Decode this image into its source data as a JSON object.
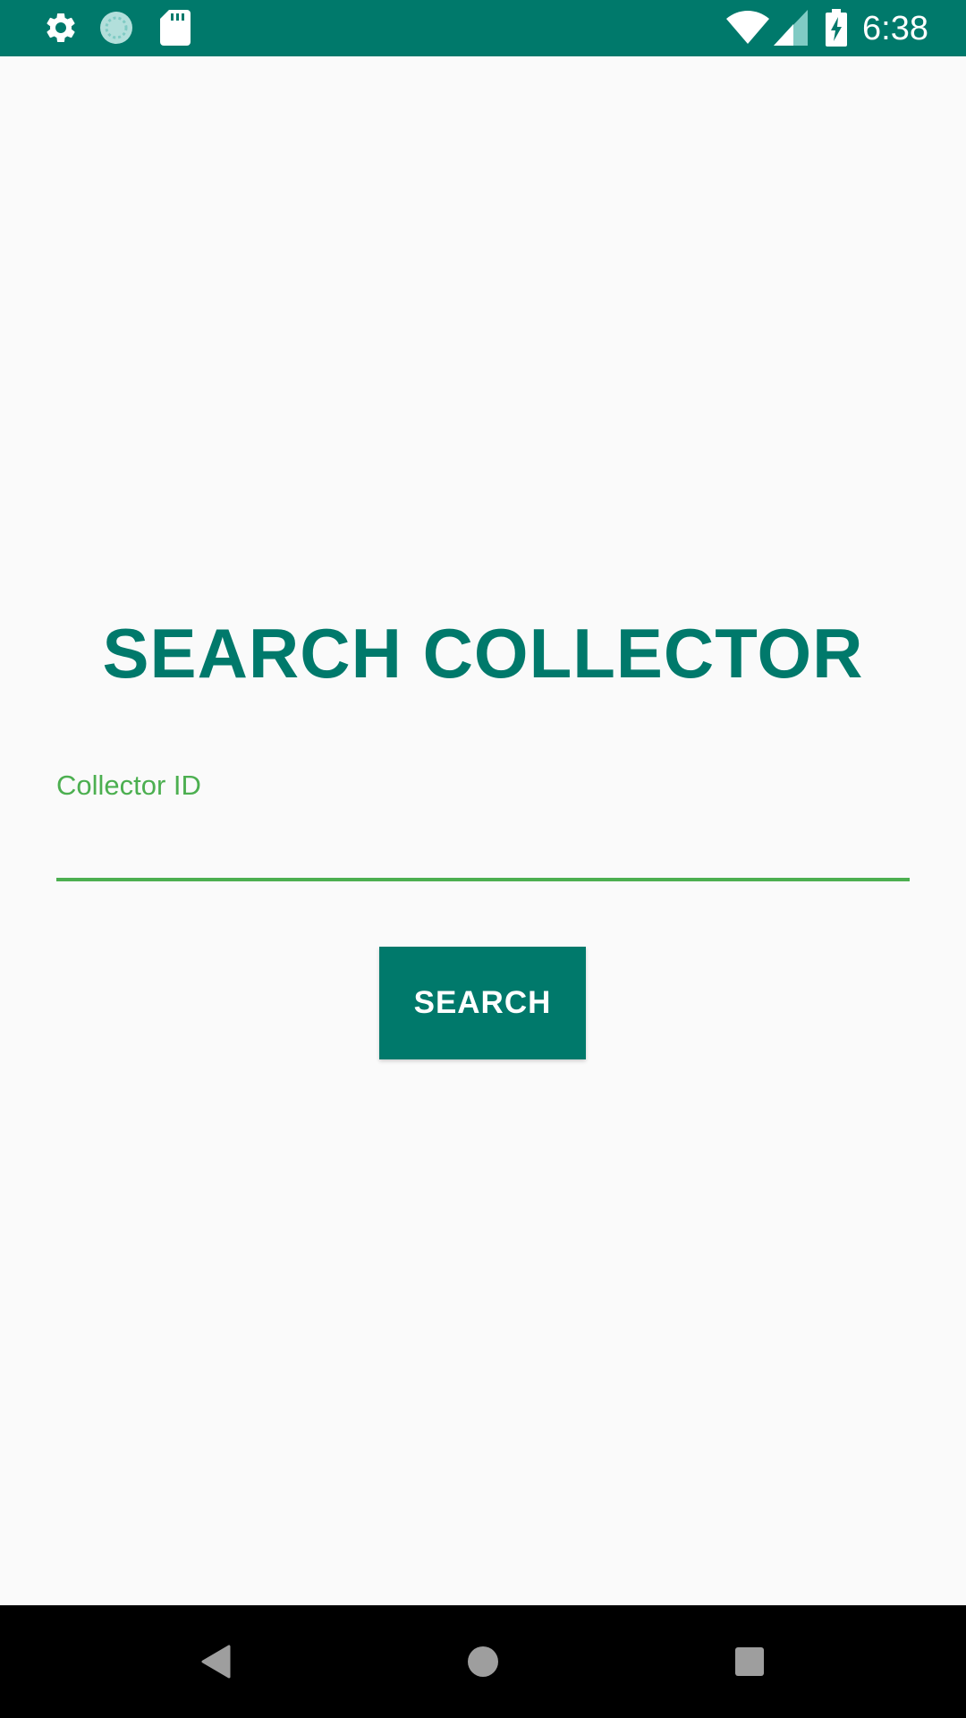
{
  "status_bar": {
    "time": "6:38",
    "left_icons": [
      "gear-icon",
      "sync-circle-icon",
      "sd-card-icon"
    ],
    "right_icons": [
      "wifi-icon",
      "cell-signal-icon",
      "battery-charging-icon"
    ],
    "color": "#00796B"
  },
  "main": {
    "title": "SEARCH COLLECTOR",
    "collector_field": {
      "label": "Collector ID",
      "value": "",
      "underline_color": "#4CAF50"
    },
    "search_button": {
      "label": "SEARCH"
    },
    "accent_color": "#00796B"
  },
  "nav_bar": {
    "buttons": [
      "back-icon",
      "home-icon",
      "recents-icon"
    ]
  }
}
